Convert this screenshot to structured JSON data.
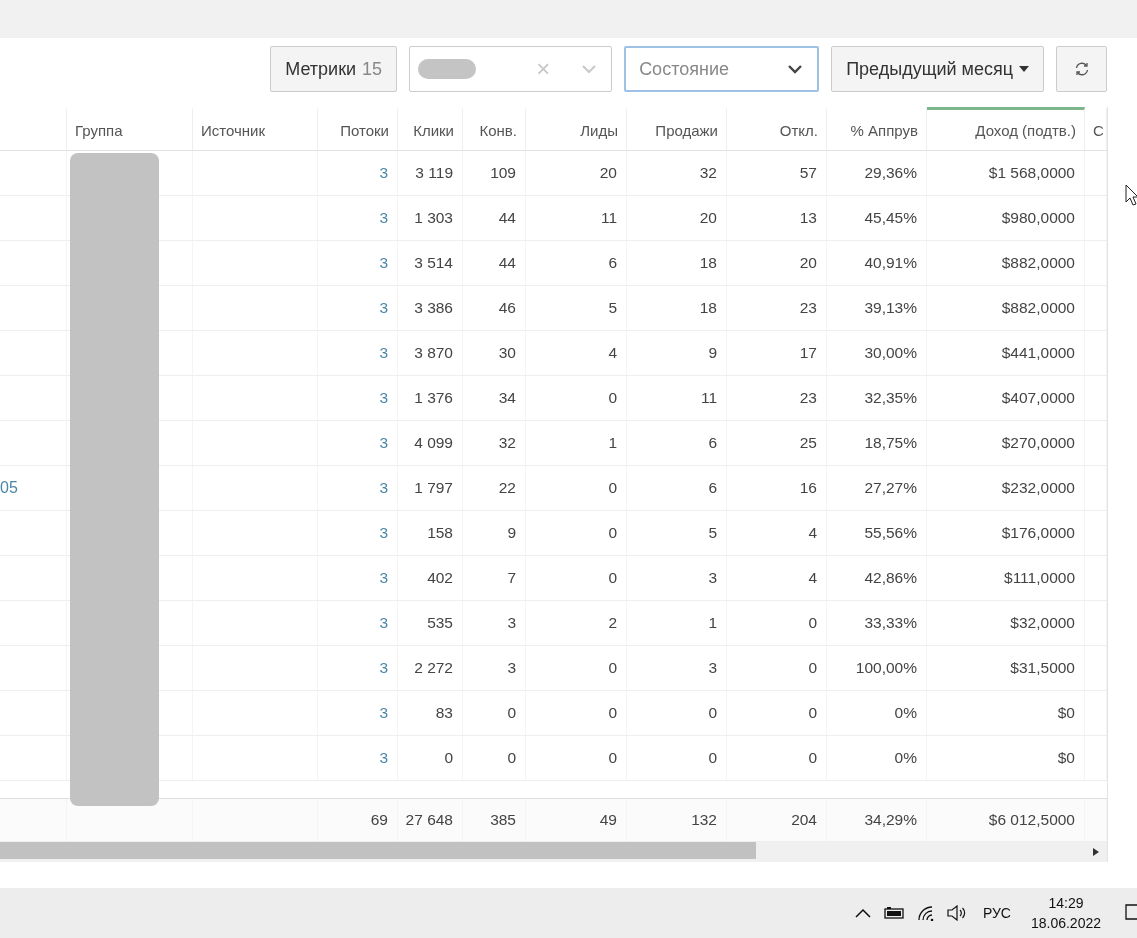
{
  "toolbar": {
    "metrics_button": {
      "label": "Метрики",
      "count": "15"
    },
    "filter_select": {
      "clear": "×"
    },
    "state_select": {
      "placeholder": "Состояние",
      "focused": true
    },
    "period_button": {
      "label": "Предыдущий месяц"
    }
  },
  "table": {
    "columns": [
      {
        "label": "Группа",
        "sorted": false
      },
      {
        "label": "Источник",
        "sorted": false
      },
      {
        "label": "Потоки",
        "sorted": false
      },
      {
        "label": "Клики",
        "sorted": false
      },
      {
        "label": "Конв.",
        "sorted": false
      },
      {
        "label": "Лиды",
        "sorted": false
      },
      {
        "label": "Продажи",
        "sorted": false
      },
      {
        "label": "Откл.",
        "sorted": false
      },
      {
        "label": "% Аппрув",
        "sorted": false
      },
      {
        "label": "Доход (подтв.)",
        "sorted": true
      },
      {
        "label": "С",
        "sorted": false
      }
    ],
    "rows": [
      {
        "values": [
          "3",
          "3 119",
          "109",
          "20",
          "32",
          "57",
          "29,36%",
          "$1 568,0000"
        ]
      },
      {
        "values": [
          "3",
          "1 303",
          "44",
          "11",
          "20",
          "13",
          "45,45%",
          "$980,0000"
        ]
      },
      {
        "values": [
          "3",
          "3 514",
          "44",
          "6",
          "18",
          "20",
          "40,91%",
          "$882,0000"
        ]
      },
      {
        "values": [
          "3",
          "3 386",
          "46",
          "5",
          "18",
          "23",
          "39,13%",
          "$882,0000"
        ]
      },
      {
        "values": [
          "3",
          "3 870",
          "30",
          "4",
          "9",
          "17",
          "30,00%",
          "$441,0000"
        ]
      },
      {
        "values": [
          "3",
          "1 376",
          "34",
          "0",
          "11",
          "23",
          "32,35%",
          "$407,0000"
        ]
      },
      {
        "values": [
          "3",
          "4 099",
          "32",
          "1",
          "6",
          "25",
          "18,75%",
          "$270,0000"
        ]
      },
      {
        "name": "05",
        "values": [
          "3",
          "1 797",
          "22",
          "0",
          "6",
          "16",
          "27,27%",
          "$232,0000"
        ]
      },
      {
        "values": [
          "3",
          "158",
          "9",
          "0",
          "5",
          "4",
          "55,56%",
          "$176,0000"
        ]
      },
      {
        "values": [
          "3",
          "402",
          "7",
          "0",
          "3",
          "4",
          "42,86%",
          "$111,0000"
        ]
      },
      {
        "values": [
          "3",
          "535",
          "3",
          "2",
          "1",
          "0",
          "33,33%",
          "$32,0000"
        ]
      },
      {
        "values": [
          "3",
          "2 272",
          "3",
          "0",
          "3",
          "0",
          "100,00%",
          "$31,5000"
        ]
      },
      {
        "values": [
          "3",
          "83",
          "0",
          "0",
          "0",
          "0",
          "0%",
          "$0"
        ]
      },
      {
        "values": [
          "3",
          "0",
          "0",
          "0",
          "0",
          "0",
          "0%",
          "$0"
        ]
      }
    ],
    "totals": [
      "69",
      "27 648",
      "385",
      "49",
      "132",
      "204",
      "34,29%",
      "$6 012,5000"
    ]
  },
  "taskbar": {
    "language": "РУС",
    "time": "14:29",
    "date": "18.06.2022"
  }
}
